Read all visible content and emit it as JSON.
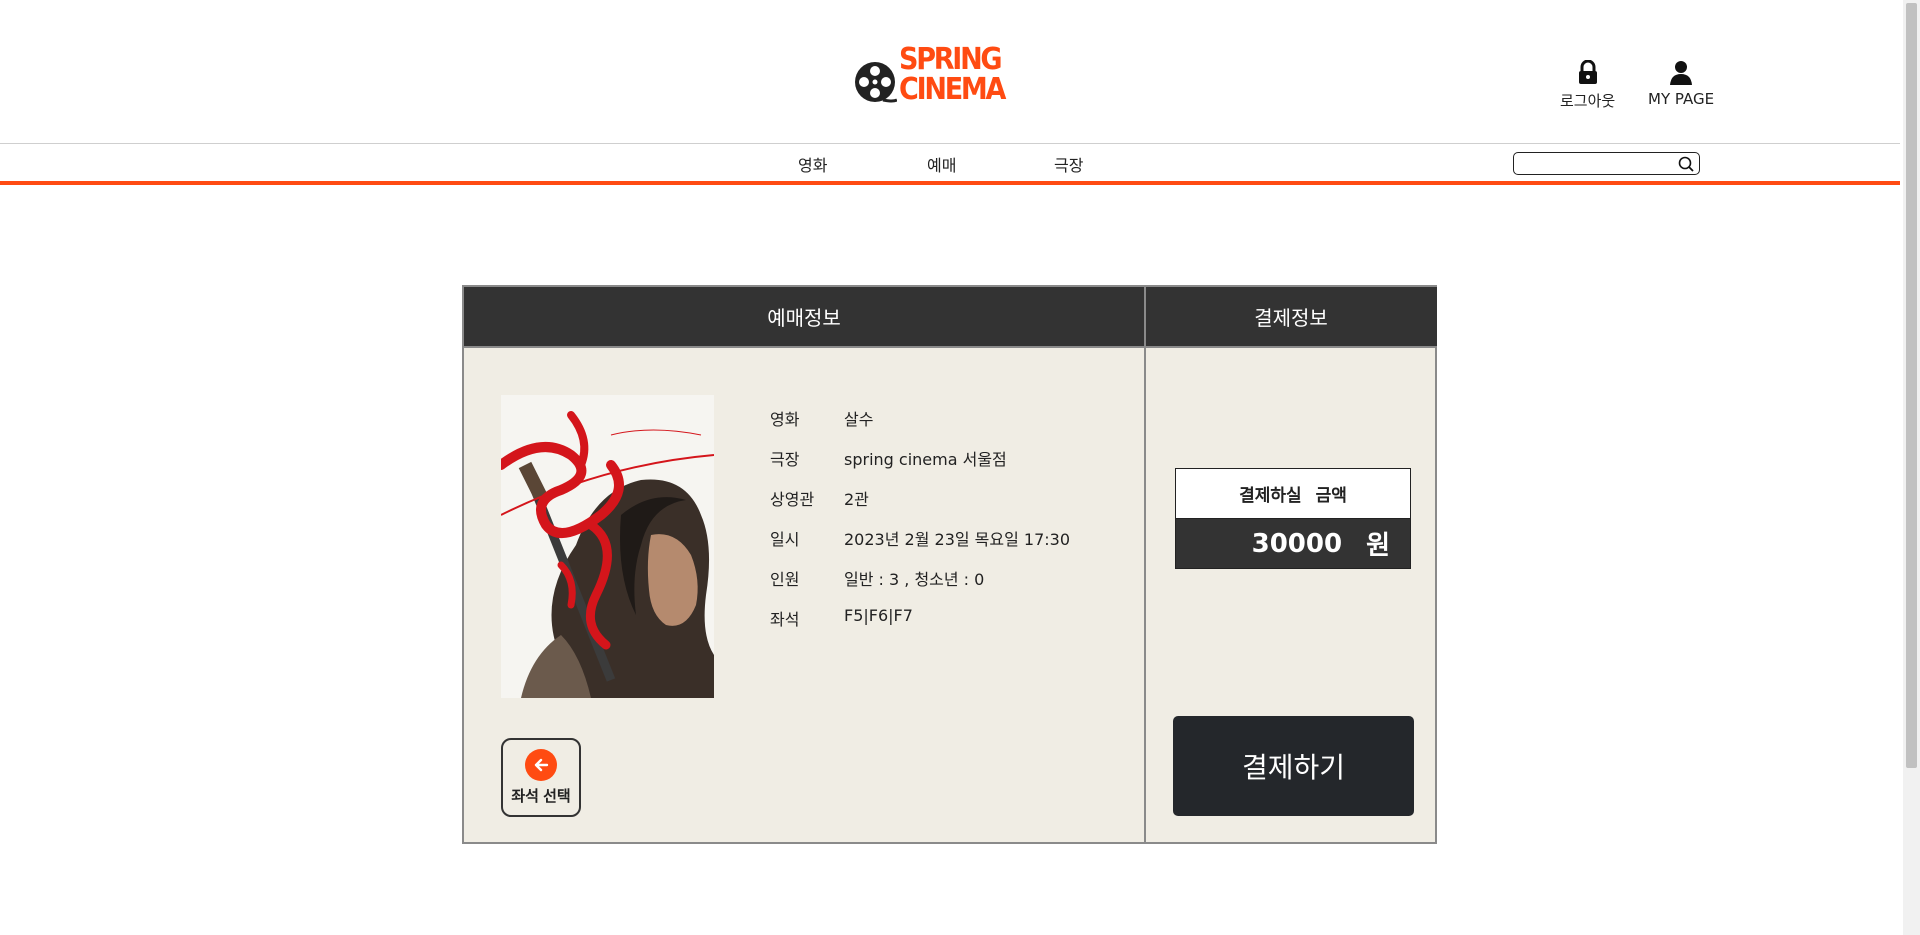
{
  "header": {
    "logo_line1": "SPRING",
    "logo_line2": "CINEMA",
    "logout_label": "로그아웃",
    "mypage_label": "MY PAGE"
  },
  "nav": {
    "items": [
      {
        "label": "영화"
      },
      {
        "label": "예매"
      },
      {
        "label": "극장"
      }
    ],
    "search_value": ""
  },
  "booking": {
    "section_title": "예매정보",
    "fields": [
      {
        "label": "영화",
        "value": "살수"
      },
      {
        "label": "극장",
        "value": "spring cinema 서울점"
      },
      {
        "label": "상영관",
        "value": "2관"
      },
      {
        "label": "일시",
        "value": "2023년 2월 23일 목요일 17:30"
      },
      {
        "label": "인원",
        "value": "일반 : 3 , 청소년 : 0"
      },
      {
        "label": "좌석",
        "value": "F5|F6|F7"
      }
    ],
    "back_button_label": "좌석 선택"
  },
  "payment": {
    "section_title": "결제정보",
    "amount_title": "결제하실 금액",
    "amount_value": "30000",
    "currency": "원",
    "pay_button_label": "결제하기"
  },
  "colors": {
    "brand_orange": "#ff4b12",
    "header_dark": "#333333",
    "panel_bg": "#f0ede4",
    "button_dark": "#24272b"
  }
}
